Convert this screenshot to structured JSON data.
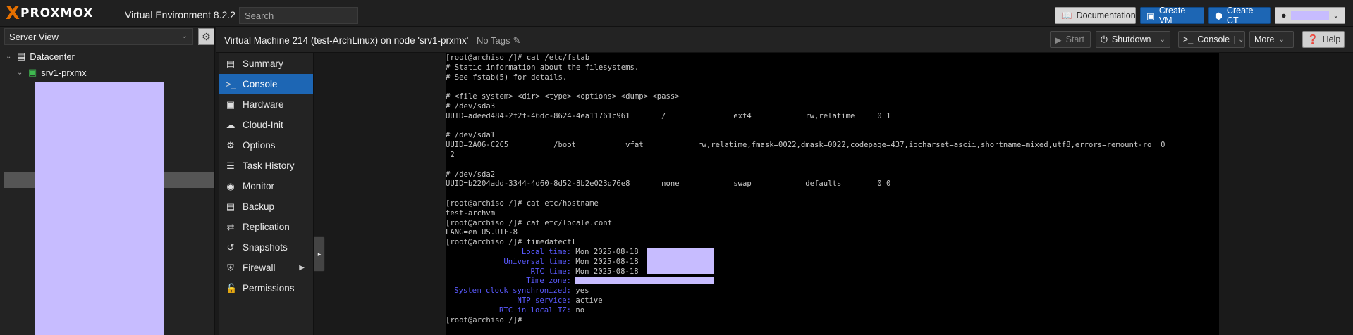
{
  "app": {
    "brand_x": "X",
    "brand_word": "PROXMOX",
    "product": "Virtual Environment 8.2.2",
    "search_placeholder": "Search"
  },
  "topbar": {
    "documentation": "Documentation",
    "create_vm": "Create VM",
    "create_ct": "Create CT"
  },
  "tree": {
    "view": "Server View",
    "datacenter": "Datacenter",
    "node": "srv1-prxmx"
  },
  "header": {
    "title": "Virtual Machine 214 (test-ArchLinux) on node 'srv1-prxmx'",
    "tags": "No Tags",
    "start": "Start",
    "shutdown": "Shutdown",
    "console": "Console",
    "more": "More",
    "help": "Help"
  },
  "nav": [
    {
      "label": "Summary",
      "icon": "summary-icon"
    },
    {
      "label": "Console",
      "icon": "console-icon"
    },
    {
      "label": "Hardware",
      "icon": "hardware-icon"
    },
    {
      "label": "Cloud-Init",
      "icon": "cloud-icon"
    },
    {
      "label": "Options",
      "icon": "gear-icon"
    },
    {
      "label": "Task History",
      "icon": "list-icon"
    },
    {
      "label": "Monitor",
      "icon": "eye-icon"
    },
    {
      "label": "Backup",
      "icon": "floppy-icon"
    },
    {
      "label": "Replication",
      "icon": "retweet-icon"
    },
    {
      "label": "Snapshots",
      "icon": "history-icon"
    },
    {
      "label": "Firewall",
      "icon": "shield-icon"
    },
    {
      "label": "Permissions",
      "icon": "unlock-icon"
    }
  ],
  "terminal": {
    "lines": [
      "[root@archiso /]# cat /etc/fstab",
      "# Static information about the filesystems.",
      "# See fstab(5) for details.",
      "",
      "# <file system> <dir> <type> <options> <dump> <pass>",
      "# /dev/sda3",
      "UUID=adeed484-2f2f-46dc-8624-4ea11761c961       /               ext4            rw,relatime     0 1",
      "",
      "# /dev/sda1",
      "UUID=2A06-C2C5          /boot           vfat            rw,relatime,fmask=0022,dmask=0022,codepage=437,iocharset=ascii,shortname=mixed,utf8,errors=remount-ro  0",
      " 2",
      "",
      "# /dev/sda2",
      "UUID=b2204add-3344-4d60-8d52-8b2e023d76e8       none            swap            defaults        0 0",
      "",
      "[root@archiso /]# cat etc/hostname",
      "test-archvm",
      "[root@archiso /]# cat etc/locale.conf",
      "LANG=en_US.UTF-8",
      "[root@archiso /]# timedatectl"
    ],
    "timedate": [
      {
        "key": "Local time:",
        "value": "Mon 2025-08-18"
      },
      {
        "key": "Universal time:",
        "value": "Mon 2025-08-18"
      },
      {
        "key": "RTC time:",
        "value": "Mon 2025-08-18"
      },
      {
        "key": "Time zone:",
        "value": ""
      },
      {
        "key": "System clock synchronized:",
        "value": "yes"
      },
      {
        "key": "NTP service:",
        "value": "active"
      },
      {
        "key": "RTC in local TZ:",
        "value": "no"
      }
    ],
    "prompt": "[root@archiso /]# _"
  }
}
